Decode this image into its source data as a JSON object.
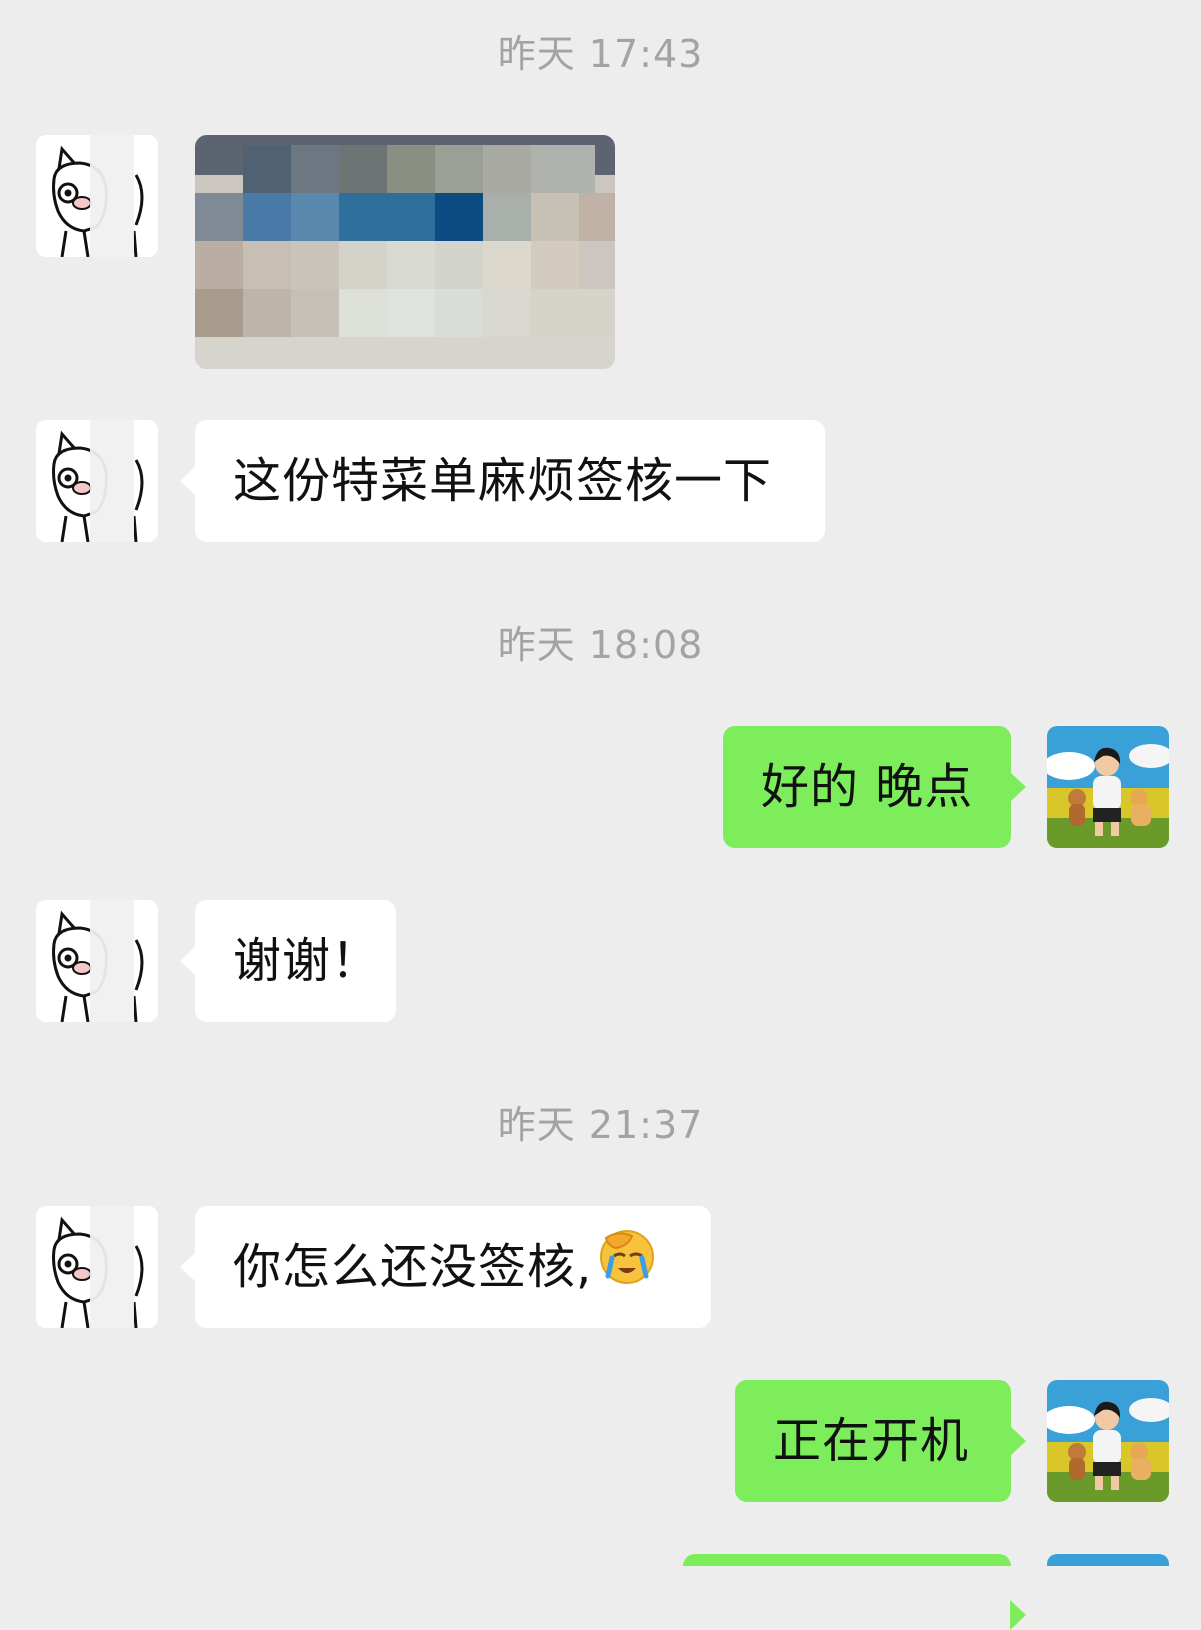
{
  "timestamps": [
    "昨天 17:43",
    "昨天 18:08",
    "昨天 21:37"
  ],
  "messages": {
    "m2": "这份特菜单麻烦签核一下",
    "m3": "好的 晚点",
    "m4": "谢谢！",
    "m5": "你怎么还没签核,",
    "m6": "正在开机"
  },
  "icons": {
    "contact_avatar": "cartoon-pig-avatar",
    "self_avatar": "boy-with-dogs-avatar",
    "emoji": "face-palm-crying-emoji"
  },
  "colors": {
    "background": "#ededed",
    "incoming_bubble": "#ffffff",
    "outgoing_bubble": "#7ded5c",
    "timestamp_text": "#a3a3a3"
  }
}
